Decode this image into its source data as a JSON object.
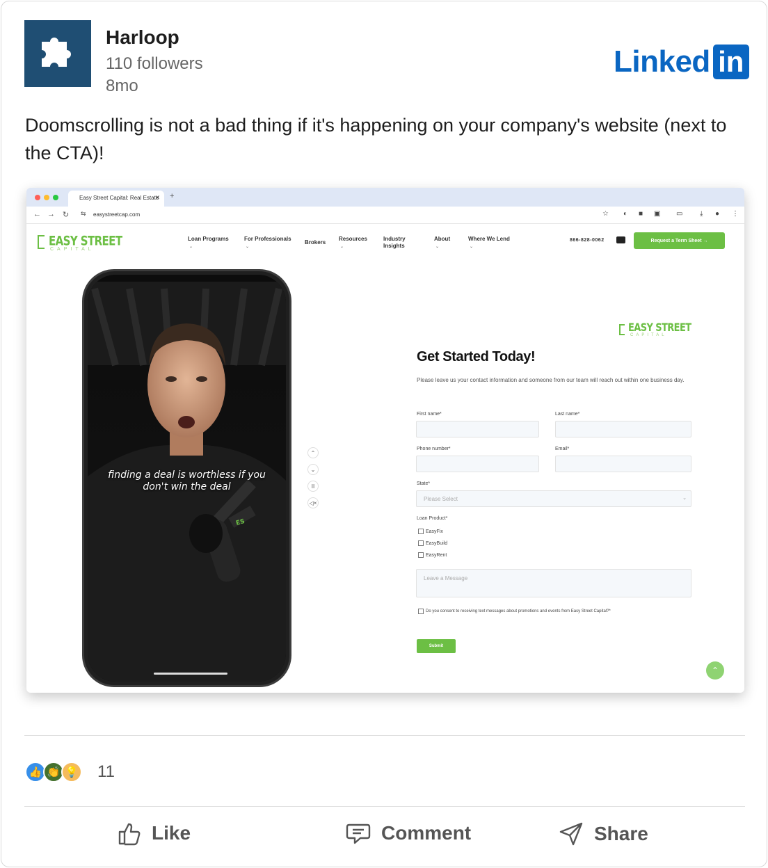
{
  "company": {
    "name": "Harloop",
    "followers": "110 followers",
    "age": "8mo"
  },
  "brand": {
    "word": "Linked",
    "badge": "in",
    "color": "#0a66c2"
  },
  "post": {
    "text": "Doomscrolling is not a bad thing if it's happening on your company's website (next to the CTA)!"
  },
  "embedded_screenshot": {
    "browser": {
      "tab_title": "Easy Street Capital: Real Estate",
      "url": "easystreetcap.com"
    },
    "site": {
      "logo_title": "EASY STREET",
      "logo_sub": "CAPITAL",
      "nav": [
        "Loan Programs",
        "For Professionals",
        "Brokers",
        "Resources",
        "Industry Insights",
        "About",
        "Where We Lend"
      ],
      "phone": "866-828-0062",
      "cta": "Request a Term Sheet →",
      "accent": "#6cbf44"
    },
    "video": {
      "caption": "finding a deal is worthless if you don't win the deal"
    },
    "form": {
      "title": "Get Started Today!",
      "description": "Please leave us your contact information and someone from our team will reach out within one business day.",
      "first_name_label": "First name*",
      "last_name_label": "Last name*",
      "phone_label": "Phone number*",
      "email_label": "Email*",
      "state_label": "State*",
      "state_placeholder": "Please Select",
      "loan_product_label": "Loan Product*",
      "loan_products": [
        "EasyFix",
        "EasyBuild",
        "EasyRent"
      ],
      "message_placeholder": "Leave a Message",
      "consent": "Do you consent to receiving text messages about promotions and events from Easy Street Capital?*",
      "submit": "Submit"
    }
  },
  "reactions": {
    "count": "11",
    "icons": [
      "like-icon",
      "celebrate-icon",
      "insightful-icon"
    ]
  },
  "actions": {
    "like": "Like",
    "comment": "Comment",
    "share": "Share"
  }
}
